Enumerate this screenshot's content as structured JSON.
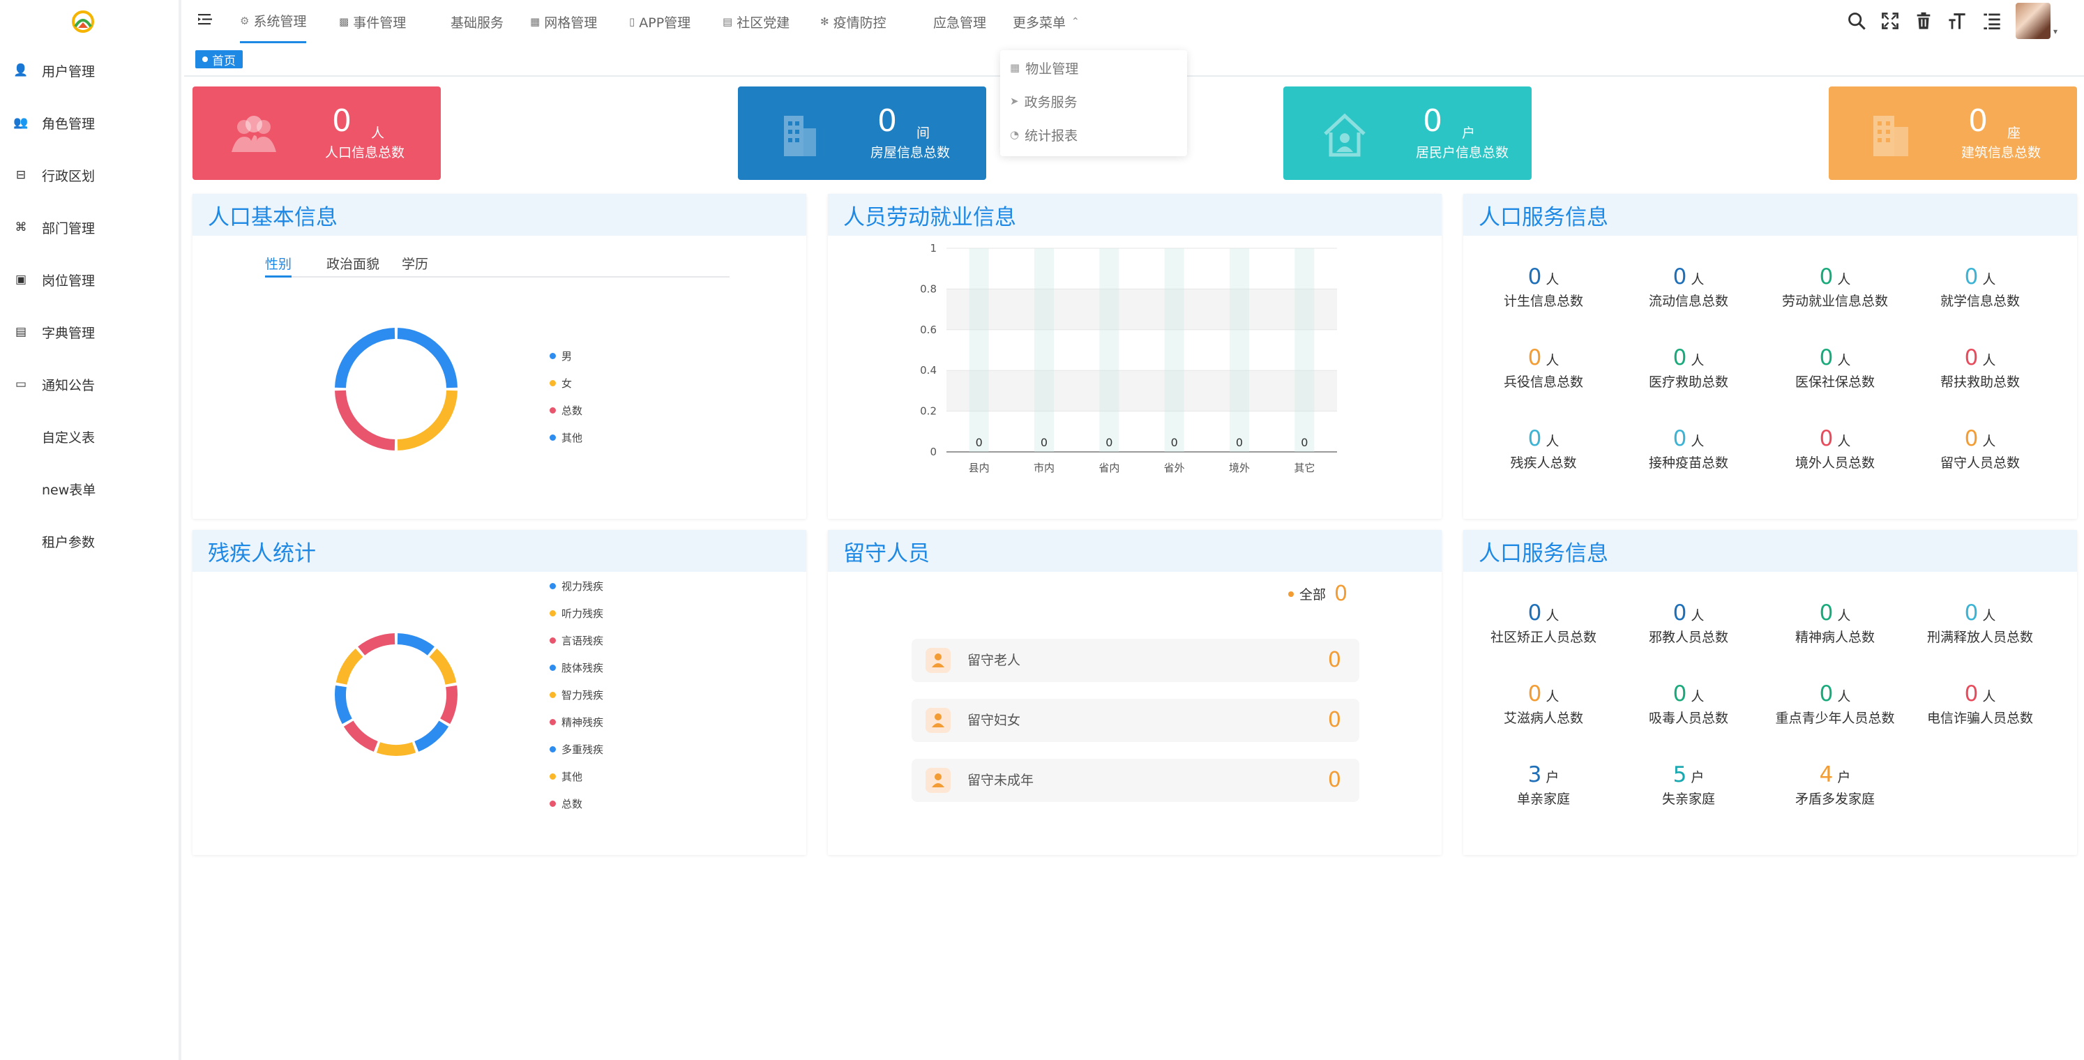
{
  "sidebar": {
    "items": [
      {
        "label": "用户管理",
        "icon": "user-icon"
      },
      {
        "label": "角色管理",
        "icon": "role-icon"
      },
      {
        "label": "行政区划",
        "icon": "region-icon"
      },
      {
        "label": "部门管理",
        "icon": "org-chart-icon"
      },
      {
        "label": "岗位管理",
        "icon": "post-icon"
      },
      {
        "label": "字典管理",
        "icon": "dictionary-icon"
      },
      {
        "label": "通知公告",
        "icon": "message-icon"
      },
      {
        "label": "自定义表",
        "icon": ""
      },
      {
        "label": "new表单",
        "icon": ""
      },
      {
        "label": "租户参数",
        "icon": ""
      }
    ]
  },
  "topnav": {
    "tabs": [
      {
        "label": "系统管理",
        "icon": "gear-icon",
        "active": true
      },
      {
        "label": "事件管理",
        "icon": "event-icon"
      },
      {
        "label": "基础服务",
        "icon": ""
      },
      {
        "label": "网格管理",
        "icon": "grid-icon"
      },
      {
        "label": "APP管理",
        "icon": "phone-icon"
      },
      {
        "label": "社区党建",
        "icon": "party-icon"
      },
      {
        "label": "疫情防控",
        "icon": "virus-icon"
      },
      {
        "label": "应急管理",
        "icon": ""
      },
      {
        "label": "更多菜单",
        "icon": ""
      }
    ]
  },
  "more_menu": {
    "items": [
      {
        "label": "物业管理",
        "icon": "building-icon"
      },
      {
        "label": "政务服务",
        "icon": "send-icon"
      },
      {
        "label": "统计报表",
        "icon": "chart-icon"
      }
    ]
  },
  "breadcrumb": {
    "home": "首页"
  },
  "stats": [
    {
      "value": "0",
      "unit": "人",
      "label": "人口信息总数",
      "color": "#ee5568"
    },
    {
      "value": "0",
      "unit": "间",
      "label": "房屋信息总数",
      "color": "#1e7fc2"
    },
    {
      "value": "0",
      "unit": "户",
      "label": "居民户信息总数",
      "color": "#2cc5c5"
    },
    {
      "value": "0",
      "unit": "座",
      "label": "建筑信息总数",
      "color": "#f6ab54"
    }
  ],
  "panel_population": {
    "title": "人口基本信息",
    "tabs": [
      "性别",
      "政治面貌",
      "学历"
    ],
    "legend": [
      {
        "name": "男",
        "color": "#2d8cf0"
      },
      {
        "name": "女",
        "color": "#fbb728"
      },
      {
        "name": "总数",
        "color": "#e8556c"
      },
      {
        "name": "其他",
        "color": "#2d8cf0"
      }
    ]
  },
  "panel_employment": {
    "title": "人员劳动就业信息",
    "chart_data": {
      "type": "bar",
      "categories": [
        "县内",
        "市内",
        "省内",
        "省外",
        "境外",
        "其它"
      ],
      "values": [
        0,
        0,
        0,
        0,
        0,
        0
      ],
      "ylim": [
        0,
        1
      ],
      "yticks": [
        "0",
        "0.2",
        "0.4",
        "0.6",
        "0.8",
        "1"
      ],
      "grid": true
    }
  },
  "panel_service1": {
    "title": "人口服务信息",
    "items": [
      {
        "value": "0",
        "unit": "人",
        "label": "计生信息总数",
        "color": "#1e6fb8"
      },
      {
        "value": "0",
        "unit": "人",
        "label": "流动信息总数",
        "color": "#1e6fb8"
      },
      {
        "value": "0",
        "unit": "人",
        "label": "劳动就业信息总数",
        "color": "#19a97b"
      },
      {
        "value": "0",
        "unit": "人",
        "label": "就学信息总数",
        "color": "#3db3d4"
      },
      {
        "value": "0",
        "unit": "人",
        "label": "兵役信息总数",
        "color": "#f39c34"
      },
      {
        "value": "0",
        "unit": "人",
        "label": "医疗救助总数",
        "color": "#19a97b"
      },
      {
        "value": "0",
        "unit": "人",
        "label": "医保社保总数",
        "color": "#19a97b"
      },
      {
        "value": "0",
        "unit": "人",
        "label": "帮扶救助总数",
        "color": "#e74c5c"
      },
      {
        "value": "0",
        "unit": "人",
        "label": "残疾人总数",
        "color": "#3db3d4"
      },
      {
        "value": "0",
        "unit": "人",
        "label": "接种疫苗总数",
        "color": "#3db3d4"
      },
      {
        "value": "0",
        "unit": "人",
        "label": "境外人员总数",
        "color": "#e74c5c"
      },
      {
        "value": "0",
        "unit": "人",
        "label": "留守人员总数",
        "color": "#f39c34"
      }
    ]
  },
  "panel_disabled": {
    "title": "残疾人统计",
    "legend": [
      {
        "name": "视力残疾",
        "color": "#2d8cf0"
      },
      {
        "name": "听力残疾",
        "color": "#fbb728"
      },
      {
        "name": "言语残疾",
        "color": "#e8556c"
      },
      {
        "name": "肢体残疾",
        "color": "#2d8cf0"
      },
      {
        "name": "智力残疾",
        "color": "#fbb728"
      },
      {
        "name": "精神残疾",
        "color": "#e8556c"
      },
      {
        "name": "多重残疾",
        "color": "#2d8cf0"
      },
      {
        "name": "其他",
        "color": "#fbb728"
      },
      {
        "name": "总数",
        "color": "#e8556c"
      }
    ]
  },
  "panel_leftbehind": {
    "title": "留守人员",
    "all_label": "全部",
    "all_value": "0",
    "rows": [
      {
        "label": "留守老人",
        "value": "0",
        "icon": "elder-icon"
      },
      {
        "label": "留守妇女",
        "value": "0",
        "icon": "woman-icon"
      },
      {
        "label": "留守未成年",
        "value": "0",
        "icon": "child-icon"
      }
    ]
  },
  "panel_service2": {
    "title": "人口服务信息",
    "items": [
      {
        "value": "0",
        "unit": "人",
        "label": "社区矫正人员总数",
        "color": "#1e6fb8"
      },
      {
        "value": "0",
        "unit": "人",
        "label": "邪教人员总数",
        "color": "#1e6fb8"
      },
      {
        "value": "0",
        "unit": "人",
        "label": "精神病人总数",
        "color": "#19a97b"
      },
      {
        "value": "0",
        "unit": "人",
        "label": "刑满释放人员总数",
        "color": "#3db3d4"
      },
      {
        "value": "0",
        "unit": "人",
        "label": "艾滋病人总数",
        "color": "#f39c34"
      },
      {
        "value": "0",
        "unit": "人",
        "label": "吸毒人员总数",
        "color": "#19a97b"
      },
      {
        "value": "0",
        "unit": "人",
        "label": "重点青少年人员总数",
        "color": "#19a97b"
      },
      {
        "value": "0",
        "unit": "人",
        "label": "电信诈骗人员总数",
        "color": "#e74c5c"
      },
      {
        "value": "3",
        "unit": "户",
        "label": "单亲家庭",
        "color": "#1e6fb8"
      },
      {
        "value": "5",
        "unit": "户",
        "label": "失亲家庭",
        "color": "#19a7b0"
      },
      {
        "value": "4",
        "unit": "户",
        "label": "矛盾多发家庭",
        "color": "#f39c34"
      }
    ]
  }
}
